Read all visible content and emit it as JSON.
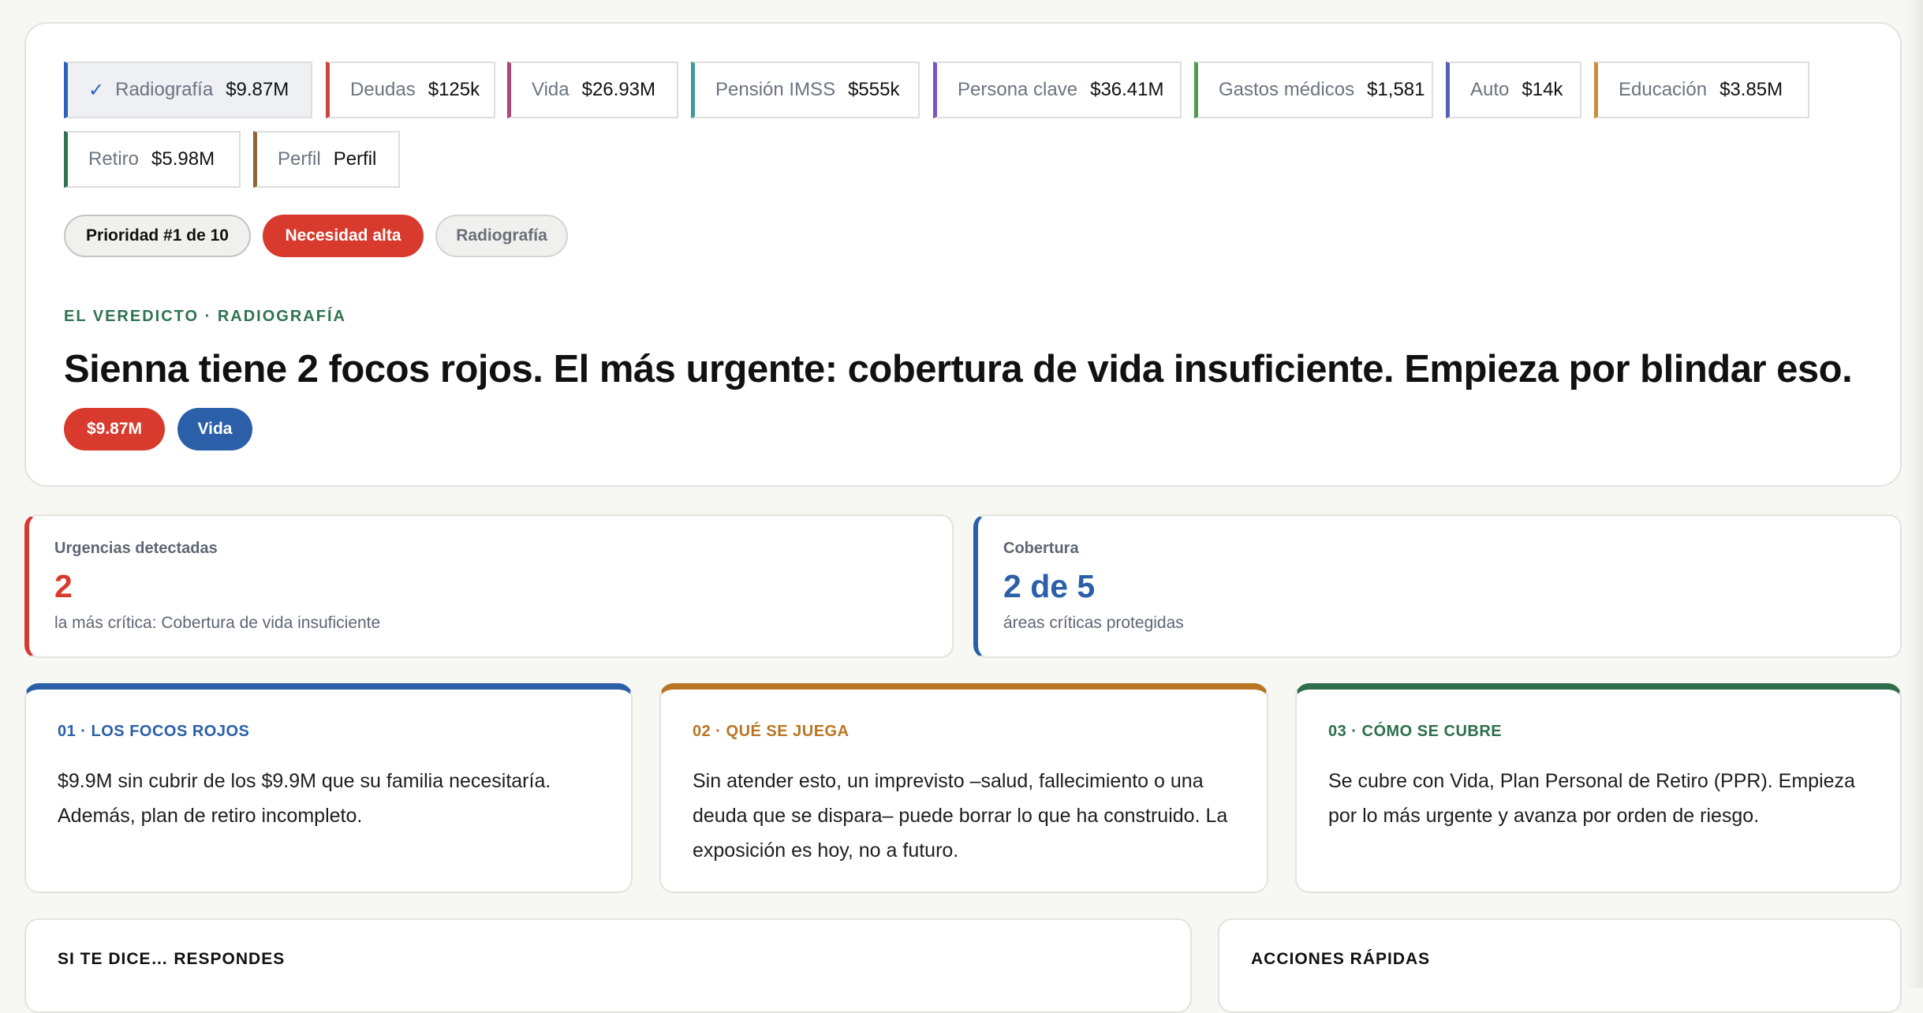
{
  "tabs": [
    {
      "label": "Radiografía",
      "value": "$9.87M",
      "color": "#2b63b9",
      "active": true,
      "check": "✓"
    },
    {
      "label": "Deudas",
      "value": "$125k",
      "color": "#c9463d"
    },
    {
      "label": "Vida",
      "value": "$26.93M",
      "color": "#b0457a"
    },
    {
      "label": "Pensión IMSS",
      "value": "$555k",
      "color": "#3f9a9a"
    },
    {
      "label": "Persona clave",
      "value": "$36.41M",
      "color": "#7a55c8"
    },
    {
      "label": "Gastos médicos",
      "value": "$1,581",
      "color": "#4e9a4e"
    },
    {
      "label": "Auto",
      "value": "$14k",
      "color": "#5560b8"
    },
    {
      "label": "Educación",
      "value": "$3.85M",
      "color": "#c4913a"
    },
    {
      "label": "Retiro",
      "value": "$5.98M",
      "color": "#2f7350"
    },
    {
      "label": "Perfil",
      "value": "Perfil",
      "color": "#8a6a3a"
    }
  ],
  "badges": {
    "priority": "Prioridad #1 de 10",
    "need": "Necesidad alta",
    "section": "Radiografía"
  },
  "verdict": {
    "eyebrow": "EL VEREDICTO · RADIOGRAFÍA",
    "headline": "Sienna tiene 2 focos rojos. El más urgente: cobertura de vida insuficiente. Empieza por blindar eso.",
    "tag_amount": "$9.87M",
    "tag_area": "Vida"
  },
  "stats": {
    "urgencies": {
      "label": "Urgencias detectadas",
      "value": "2",
      "sub": "la más crítica: Cobertura de vida insuficiente"
    },
    "coverage": {
      "label": "Cobertura",
      "value": "2 de 5",
      "sub": "áreas críticas protegidas"
    }
  },
  "cards": [
    {
      "title": "01 · LOS FOCOS ROJOS",
      "body": "$9.9M sin cubrir de los $9.9M que su familia necesitaría. Además, plan de retiro incompleto."
    },
    {
      "title": "02 · QUÉ SE JUEGA",
      "body": "Sin atender esto, un imprevisto –salud, fallecimiento o una deuda que se dispara– puede borrar lo que ha construido. La exposición es hoy, no a futuro."
    },
    {
      "title": "03 · CÓMO SE CUBRE",
      "body": "Se cubre con Vida, Plan Personal de Retiro (PPR). Empieza por lo más urgente y avanza por orden de riesgo."
    }
  ],
  "panels": {
    "responses_title": "SI TE DICE… RESPONDES",
    "actions_title": "ACCIONES RÁPIDAS"
  },
  "colors": {
    "red": "#d83a2e",
    "blue": "#2b5fa8",
    "orange": "#b87624",
    "green": "#2f6e4c"
  }
}
